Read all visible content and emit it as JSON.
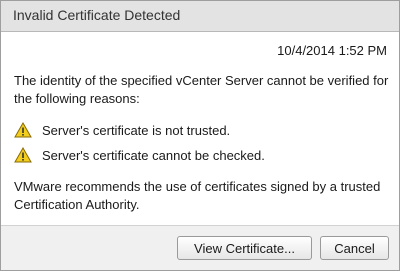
{
  "dialog": {
    "title": "Invalid Certificate Detected",
    "timestamp": "10/4/2014 1:52 PM",
    "intro": "The identity of the specified vCenter Server cannot be verified for the following reasons:",
    "reasons": [
      {
        "icon": "warning-icon",
        "text": "Server's certificate is not trusted."
      },
      {
        "icon": "warning-icon",
        "text": "Server's certificate cannot be checked."
      }
    ],
    "recommendation": "VMware recommends the use of certificates signed by a trusted Certification Authority."
  },
  "buttons": {
    "view_certificate": "View Certificate...",
    "cancel": "Cancel"
  },
  "colors": {
    "titlebar": "#e3e3e3",
    "footer": "#f0f0f0",
    "warning_fill": "#f2cf1f",
    "warning_stroke": "#8a6a00"
  }
}
